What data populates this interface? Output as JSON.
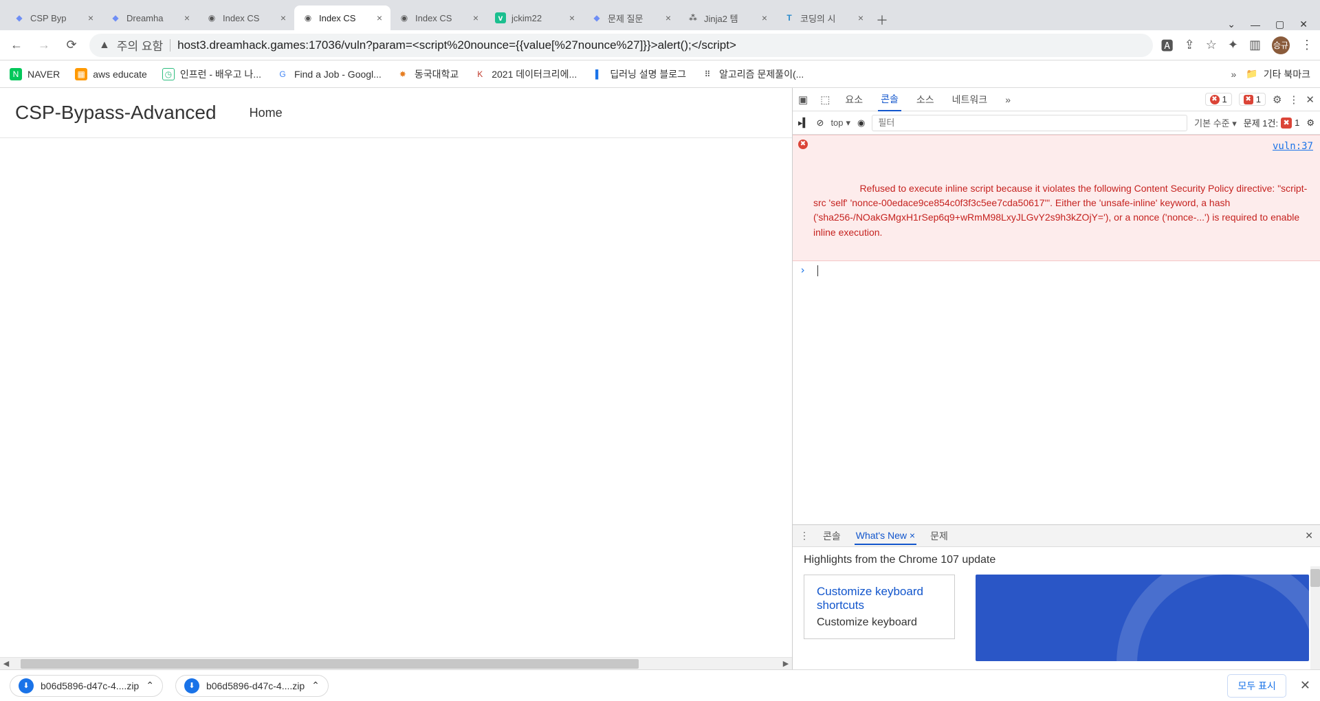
{
  "tabs": [
    {
      "title": "CSP Byp",
      "icon": "◆",
      "color": "#6e8ef5"
    },
    {
      "title": "Dreamha",
      "icon": "◆",
      "color": "#6e8ef5"
    },
    {
      "title": "Index CS",
      "icon": "◉",
      "color": "#555"
    },
    {
      "title": "Index CS",
      "icon": "◉",
      "color": "#555",
      "active": true
    },
    {
      "title": "Index CS",
      "icon": "◉",
      "color": "#555"
    },
    {
      "title": "jckim22",
      "icon": "v",
      "color": "#1bbf8f"
    },
    {
      "title": "문제 질문",
      "icon": "◆",
      "color": "#6e8ef5"
    },
    {
      "title": "Jinja2 템",
      "icon": "⁂",
      "color": "#333"
    },
    {
      "title": "코딩의 시",
      "icon": "T",
      "color": "#2a8acb"
    }
  ],
  "omnibox": {
    "secure_label": "주의 요함",
    "url": "host3.dreamhack.games:17036/vuln?param=<script%20nounce={{value[%27nounce%27]}}>alert();</script>"
  },
  "profile_initials": "승규",
  "bookmarks": [
    {
      "label": "NAVER",
      "bg": "#03c75a",
      "glyph": "N"
    },
    {
      "label": "aws educate",
      "bg": "#ff9900",
      "glyph": "▦"
    },
    {
      "label": "인프런 - 배우고 나...",
      "bg": "#ffffff",
      "glyph": "◷",
      "fg": "#2bbd7e"
    },
    {
      "label": "Find a Job - Googl...",
      "bg": "#ffffff",
      "glyph": "G",
      "fg": "#4285f4"
    },
    {
      "label": "동국대학교",
      "bg": "#ffffff",
      "glyph": "✸",
      "fg": "#e67e22"
    },
    {
      "label": "2021 데이터크리에...",
      "bg": "#ffffff",
      "glyph": "K",
      "fg": "#c0392b"
    },
    {
      "label": "딥러닝 설명 블로그",
      "bg": "#ffffff",
      "glyph": "▌",
      "fg": "#1a73e8"
    },
    {
      "label": "알고리즘 문제풀이(...",
      "bg": "#ffffff",
      "glyph": "⠿",
      "fg": "#333"
    }
  ],
  "bookmarks_folder": "기타 북마크",
  "page": {
    "title": "CSP-Bypass-Advanced",
    "home": "Home"
  },
  "devtools": {
    "tabs": [
      "요소",
      "콘솔",
      "소스",
      "네트워크"
    ],
    "active_tab": "콘솔",
    "more": "»",
    "error_count": "1",
    "issue_count": "1",
    "toolbar": {
      "context": "top",
      "filter_placeholder": "필터",
      "level": "기본 수준",
      "issues_label": "문제 1건:"
    },
    "error_message": "Refused to execute inline script because it violates the following Content Security Policy directive: \"script-src 'self' 'nonce-00edace9ce854c0f3f3c5ee7cda50617'\". Either the 'unsafe-inline' keyword, a hash ('sha256-/NOakGMgxH1rSep6q9+wRmM98LxyJLGvY2s9h3kZOjY='), or a nonce ('nonce-...') is required to enable inline execution.",
    "error_source": "vuln:37",
    "drawer": {
      "tabs": [
        "콘솔",
        "What's New",
        "문제"
      ],
      "active": "What's New",
      "headline": "Highlights from the Chrome 107 update",
      "card_title": "Customize keyboard shortcuts",
      "card_sub": "Customize keyboard"
    }
  },
  "downloads": {
    "items": [
      {
        "name": "b06d5896-d47c-4....zip"
      },
      {
        "name": "b06d5896-d47c-4....zip"
      }
    ],
    "show_all": "모두 표시"
  }
}
